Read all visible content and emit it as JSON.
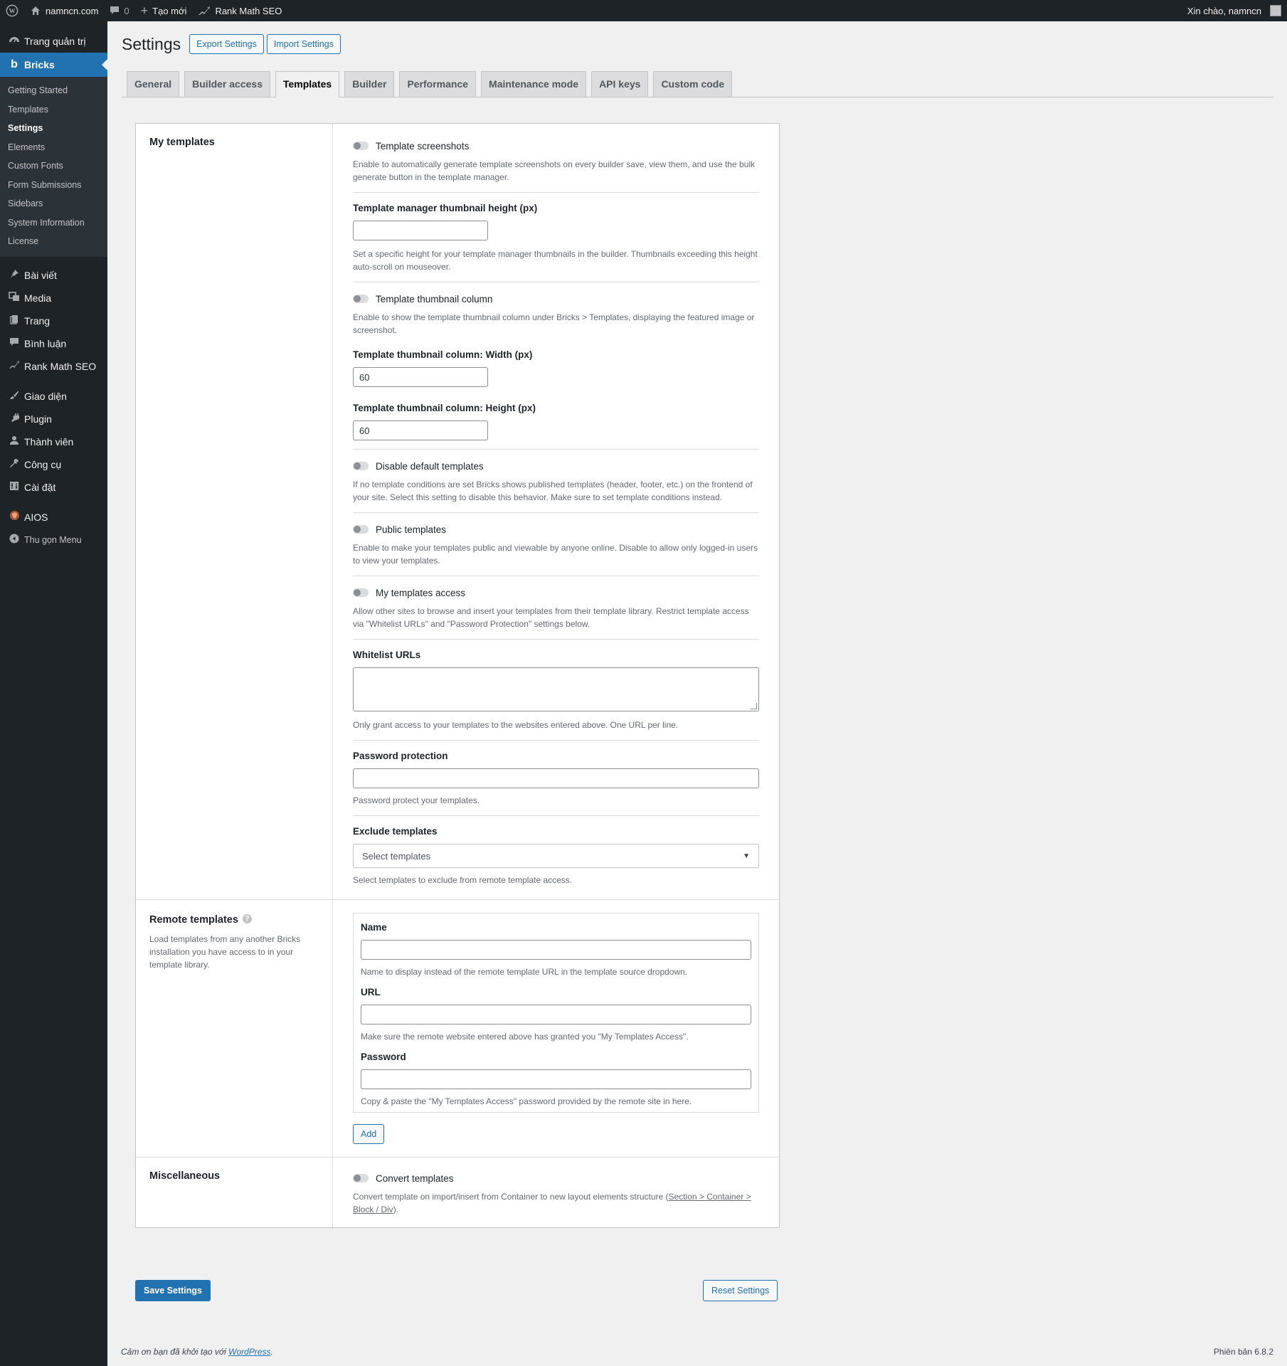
{
  "adminbar": {
    "site": "namncn.com",
    "comments": "0",
    "new": "Tạo mới",
    "seo": "Rank Math SEO",
    "greeting": "Xin chào, namncn"
  },
  "sidebar": {
    "dashboard": "Trang quản trị",
    "bricks": "Bricks",
    "bricks_sub": [
      "Getting Started",
      "Templates",
      "Settings",
      "Elements",
      "Custom Fonts",
      "Form Submissions",
      "Sidebars",
      "System Information",
      "License"
    ],
    "group2": [
      "Bài viết",
      "Media",
      "Trang",
      "Bình luận",
      "Rank Math SEO"
    ],
    "group3": [
      "Giao diện",
      "Plugin",
      "Thành viên",
      "Công cụ",
      "Cài đặt"
    ],
    "aios": "AIOS",
    "collapse": "Thu gọn Menu"
  },
  "header": {
    "title": "Settings",
    "export": "Export Settings",
    "import": "Import Settings"
  },
  "tabs": [
    "General",
    "Builder access",
    "Templates",
    "Builder",
    "Performance",
    "Maintenance mode",
    "API keys",
    "Custom code"
  ],
  "my_templates": {
    "title": "My templates",
    "screenshots_label": "Template screenshots",
    "screenshots_desc": "Enable to automatically generate template screenshots on every builder save, view them, and use the bulk generate button in the template manager.",
    "thumb_height_label": "Template manager thumbnail height (px)",
    "thumb_height_value": "",
    "thumb_height_desc": "Set a specific height for your template manager thumbnails in the builder. Thumbnails exceeding this height auto-scroll on mouseover.",
    "thumb_column_label": "Template thumbnail column",
    "thumb_column_desc": "Enable to show the template thumbnail column under Bricks > Templates, displaying the featured image or screenshot.",
    "col_width_label": "Template thumbnail column: Width (px)",
    "col_width_value": "60",
    "col_height_label": "Template thumbnail column: Height (px)",
    "col_height_value": "60",
    "disable_default_label": "Disable default templates",
    "disable_default_desc": "If no template conditions are set Bricks shows published templates (header, footer, etc.) on the frontend of your site. Select this setting to disable this behavior. Make sure to set template conditions instead.",
    "public_label": "Public templates",
    "public_desc": "Enable to make your templates public and viewable by anyone online. Disable to allow only logged-in users to view your templates.",
    "access_label": "My templates access",
    "access_desc": "Allow other sites to browse and insert your templates from their template library. Restrict template access via \"Whitelist URLs\" and \"Password Protection\" settings below.",
    "whitelist_label": "Whitelist URLs",
    "whitelist_desc": "Only grant access to your templates to the websites entered above. One URL per line.",
    "password_label": "Password protection",
    "password_desc": "Password protect your templates.",
    "exclude_label": "Exclude templates",
    "exclude_placeholder": "Select templates",
    "exclude_desc": "Select templates to exclude from remote template access."
  },
  "remote": {
    "title": "Remote templates",
    "desc": "Load templates from any another Bricks installation you have access to in your template library.",
    "name_label": "Name",
    "name_desc": "Name to display instead of the remote template URL in the template source dropdown.",
    "url_label": "URL",
    "url_desc": "Make sure the remote website entered above has granted you \"My Templates Access\".",
    "password_label": "Password",
    "password_desc": "Copy & paste the \"My Templates Access\" password provided by the remote site in here.",
    "add": "Add"
  },
  "misc": {
    "title": "Miscellaneous",
    "convert_label": "Convert templates",
    "convert_desc_a": "Convert template on import/insert from Container to new layout elements structure (",
    "convert_link": "Section > Container > Block / Div",
    "convert_desc_b": ")."
  },
  "actions": {
    "save": "Save Settings",
    "reset": "Reset Settings"
  },
  "footer": {
    "thanks": "Cảm ơn bạn đã khởi tạo với ",
    "wp": "WordPress",
    "dot": ".",
    "version": "Phiên bản 6.8.2"
  }
}
